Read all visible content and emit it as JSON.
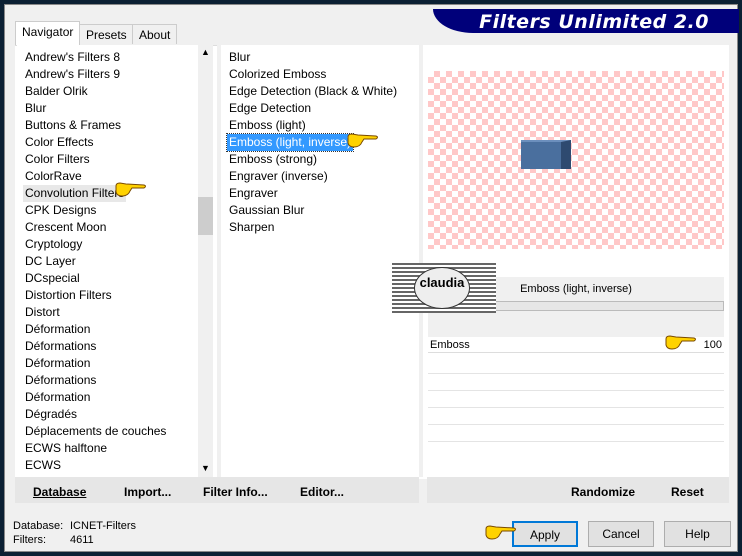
{
  "title": "Filters Unlimited 2.0",
  "tabs": [
    {
      "label": "Navigator"
    },
    {
      "label": "Presets"
    },
    {
      "label": "About"
    }
  ],
  "categories": [
    "Andrew's Filters 8",
    "Andrew's Filters 9",
    "Balder Olrik",
    "Blur",
    "Buttons & Frames",
    "Color Effects",
    "Color Filters",
    "ColorRave",
    "Convolution Filters",
    "CPK Designs",
    "Crescent Moon",
    "Cryptology",
    "DC Layer",
    "DCspecial",
    "Distortion Filters",
    "Distort",
    "Déformation",
    "Déformations",
    "Déformation",
    "Déformations",
    "Déformation",
    "Dégradés",
    "Déplacements de couches",
    "ECWS halftone",
    "ECWS"
  ],
  "selected_category": "Convolution Filters",
  "filters": [
    "Blur",
    "Colorized Emboss",
    "Edge Detection (Black & White)",
    "Edge Detection",
    "Emboss (light)",
    "Emboss (light, inverse)",
    "Emboss (strong)",
    "Engraver (inverse)",
    "Engraver",
    "Gaussian Blur",
    "Sharpen"
  ],
  "selected_filter": "Emboss (light, inverse)",
  "preview": {
    "filter_name": "Emboss (light, inverse)",
    "watermark": "claudia",
    "block_color": "#4a6f9e"
  },
  "params": [
    {
      "label": "Emboss",
      "value": "100"
    }
  ],
  "left_buttons": {
    "database": "Database",
    "import": "Import...",
    "filter_info": "Filter Info...",
    "editor": "Editor..."
  },
  "right_buttons": {
    "randomize": "Randomize",
    "reset": "Reset"
  },
  "status": {
    "database_label": "Database:",
    "database_value": "ICNET-Filters",
    "filters_label": "Filters:",
    "filters_value": "4611"
  },
  "dialog_buttons": {
    "apply": "Apply",
    "cancel": "Cancel",
    "help": "Help"
  },
  "colors": {
    "banner": "#00007a",
    "selection": "#3399ff",
    "checker": "#ffc8c8"
  }
}
